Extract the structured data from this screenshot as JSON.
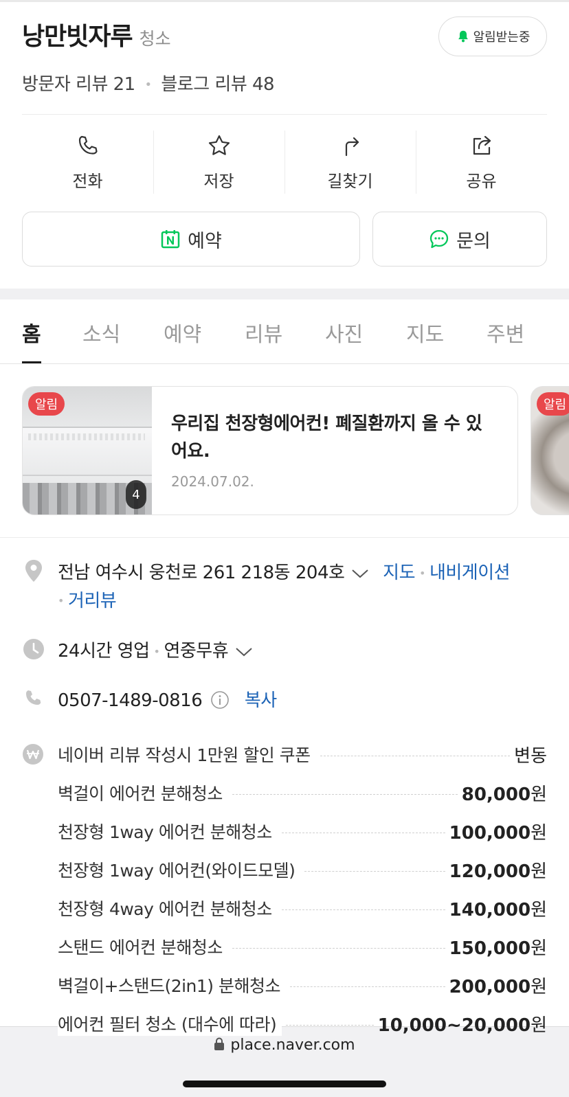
{
  "place": {
    "name": "낭만빗자루",
    "category": "청소",
    "alarm_label": "알림받는중",
    "visitor_reviews": "방문자 리뷰 21",
    "blog_reviews": "블로그 리뷰 48"
  },
  "actions": [
    {
      "label": "전화",
      "icon": "phone-icon"
    },
    {
      "label": "저장",
      "icon": "star-icon"
    },
    {
      "label": "길찾기",
      "icon": "directions-icon"
    },
    {
      "label": "공유",
      "icon": "share-icon"
    }
  ],
  "buttons": {
    "reserve": "예약",
    "inquiry": "문의"
  },
  "tabs": [
    "홈",
    "소식",
    "예약",
    "리뷰",
    "사진",
    "지도",
    "주변"
  ],
  "news": {
    "badge": "알림",
    "count": "4",
    "title": "우리집 천장형에어컨! 폐질환까지 올 수 있어요.",
    "date": "2024.07.02.",
    "next_badge": "알림"
  },
  "info": {
    "address": "전남 여수시 웅천로 261 218동 204호",
    "map_link": "지도",
    "navi_link": "내비게이션",
    "street_link": "거리뷰",
    "hours": "24시간 영업",
    "hours_note": "연중무휴",
    "phone": "0507-1489-0816",
    "copy_link": "복사"
  },
  "prices": [
    {
      "name": "네이버 리뷰 작성시 1만원 할인 쿠폰",
      "value": "변동",
      "unit": ""
    },
    {
      "name": "벽걸이 에어컨 분해청소",
      "value": "80,000",
      "unit": "원"
    },
    {
      "name": "천장형 1way 에어컨 분해청소",
      "value": "100,000",
      "unit": "원"
    },
    {
      "name": "천장형 1way 에어컨(와이드모델)",
      "value": "120,000",
      "unit": "원"
    },
    {
      "name": "천장형 4way 에어컨 분해청소",
      "value": "140,000",
      "unit": "원"
    },
    {
      "name": "스탠드 에어컨 분해청소",
      "value": "150,000",
      "unit": "원"
    },
    {
      "name": "벽걸이+스탠드(2in1) 분해청소",
      "value": "200,000",
      "unit": "원"
    },
    {
      "name": "에어컨 필터 청소 (대수에 따라)",
      "value": "10,000~20,000",
      "unit": "원"
    }
  ],
  "browser": {
    "url": "place.naver.com"
  },
  "colors": {
    "link": "#1c63b6",
    "alarm_badge": "#e8474b",
    "naver_green": "#03c75a"
  }
}
